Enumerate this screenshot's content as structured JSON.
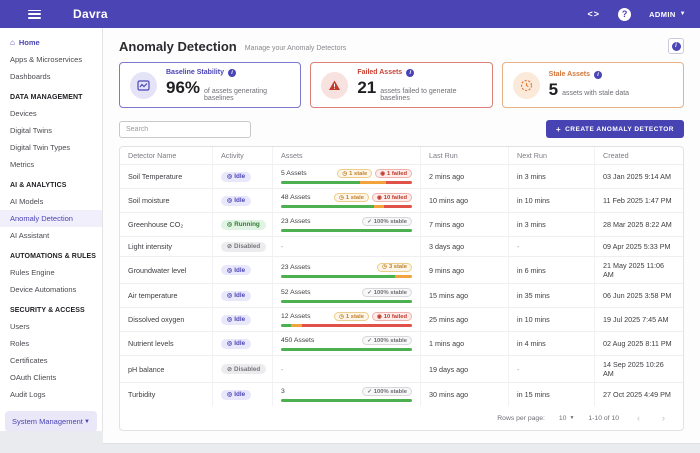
{
  "topbar": {
    "logo": "Davra",
    "code_icon": "<>",
    "help_icon": "?",
    "user_label": "ADMIN"
  },
  "sidebar": {
    "items": [
      {
        "type": "home",
        "label": "Home"
      },
      {
        "type": "link",
        "label": "Apps & Microservices"
      },
      {
        "type": "link",
        "label": "Dashboards"
      },
      {
        "type": "section",
        "label": "DATA MANAGEMENT"
      },
      {
        "type": "link",
        "label": "Devices"
      },
      {
        "type": "link",
        "label": "Digital Twins"
      },
      {
        "type": "link",
        "label": "Digital Twin Types"
      },
      {
        "type": "link",
        "label": "Metrics"
      },
      {
        "type": "section",
        "label": "AI & ANALYTICS"
      },
      {
        "type": "link",
        "label": "AI Models"
      },
      {
        "type": "link",
        "label": "Anomaly Detection",
        "selected": true
      },
      {
        "type": "link",
        "label": "AI Assistant"
      },
      {
        "type": "section",
        "label": "AUTOMATIONS & RULES"
      },
      {
        "type": "link",
        "label": "Rules Engine"
      },
      {
        "type": "link",
        "label": "Device Automations"
      },
      {
        "type": "section",
        "label": "SECURITY & ACCESS"
      },
      {
        "type": "link",
        "label": "Users"
      },
      {
        "type": "link",
        "label": "Roles"
      },
      {
        "type": "link",
        "label": "Certificates"
      },
      {
        "type": "link",
        "label": "OAuth Clients"
      },
      {
        "type": "link",
        "label": "Audit Logs"
      },
      {
        "type": "dropdown",
        "label": "System Management"
      }
    ]
  },
  "header": {
    "title": "Anomaly Detection",
    "subtitle": "Manage your Anomaly Detectors"
  },
  "cards": [
    {
      "title": "Baseline Stability",
      "value": "96%",
      "description": "of assets generating baselines",
      "color": "#4a44b6",
      "icon": "baseline-chart-icon"
    },
    {
      "title": "Failed Assets",
      "value": "21",
      "description": "assets failed to generate baselines",
      "color": "#cb4335",
      "icon": "warning-triangle-icon"
    },
    {
      "title": "Stale Assets",
      "value": "5",
      "description": "assets with stale data",
      "color": "#d2763a",
      "icon": "stale-clock-icon"
    }
  ],
  "toolbar": {
    "search_placeholder": "Search",
    "create_button": "CREATE ANOMALY DETECTOR"
  },
  "table": {
    "columns": [
      "Detector Name",
      "Activity",
      "Assets",
      "Last Run",
      "Next Run",
      "Created"
    ],
    "rows": [
      {
        "name": "Soil Temperature",
        "activity": "Idle",
        "assets_label": "5 Assets",
        "badges": [
          {
            "type": "stale",
            "label": "1 stale"
          },
          {
            "type": "failed",
            "label": "1 failed"
          }
        ],
        "bar": {
          "stable": 60,
          "stale": 20,
          "failed": 20
        },
        "last_run": "2 mins ago",
        "next_run": "in 3 mins",
        "created": "03 Jan 2025 9:14 AM"
      },
      {
        "name": "Soil moisture",
        "activity": "Idle",
        "assets_label": "48 Assets",
        "badges": [
          {
            "type": "stale",
            "label": "1 stale"
          },
          {
            "type": "failed",
            "label": "10 failed"
          }
        ],
        "bar": {
          "stable": 71,
          "stale": 8,
          "failed": 21
        },
        "last_run": "10 mins ago",
        "next_run": "in 10 mins",
        "created": "11 Feb 2025 1:47 PM"
      },
      {
        "name": "Greenhouse CO₂",
        "activity": "Running",
        "assets_label": "23 Assets",
        "badges": [
          {
            "type": "stable",
            "label": "100% stable"
          }
        ],
        "bar": {
          "stable": 100,
          "stale": 0,
          "failed": 0
        },
        "last_run": "7 mins ago",
        "next_run": "in 3 mins",
        "created": "28 Mar 2025 8:22 AM"
      },
      {
        "name": "Light intensity",
        "activity": "Disabled",
        "assets_label": "-",
        "badges": [],
        "bar": null,
        "last_run": "3 days ago",
        "next_run": "-",
        "created": "09 Apr 2025 5:33 PM"
      },
      {
        "name": "Groundwater level",
        "activity": "Idle",
        "assets_label": "23 Assets",
        "badges": [
          {
            "type": "stale",
            "label": "3 stale"
          }
        ],
        "bar": {
          "stable": 87,
          "stale": 13,
          "failed": 0
        },
        "last_run": "9 mins ago",
        "next_run": "in 6 mins",
        "created": "21 May 2025 11:06 AM"
      },
      {
        "name": "Air temperature",
        "activity": "Idle",
        "assets_label": "52 Assets",
        "badges": [
          {
            "type": "stable",
            "label": "100% stable"
          }
        ],
        "bar": {
          "stable": 100,
          "stale": 0,
          "failed": 0
        },
        "last_run": "15 mins ago",
        "next_run": "in 35 mins",
        "created": "06 Jun 2025 3:58 PM"
      },
      {
        "name": "Dissolved oxygen",
        "activity": "Idle",
        "assets_label": "12 Assets",
        "badges": [
          {
            "type": "stale",
            "label": "1 stale"
          },
          {
            "type": "failed",
            "label": "10 failed"
          }
        ],
        "bar": {
          "stable": 8,
          "stale": 8,
          "failed": 84
        },
        "last_run": "25 mins ago",
        "next_run": "in 10 mins",
        "created": "19 Jul 2025 7:45 AM"
      },
      {
        "name": "Nutrient levels",
        "activity": "Idle",
        "assets_label": "450 Assets",
        "badges": [
          {
            "type": "stable",
            "label": "100% stable"
          }
        ],
        "bar": {
          "stable": 100,
          "stale": 0,
          "failed": 0
        },
        "last_run": "1 mins ago",
        "next_run": "in 4 mins",
        "created": "02 Aug 2025 8:11 PM"
      },
      {
        "name": "pH balance",
        "activity": "Disabled",
        "assets_label": "-",
        "badges": [],
        "bar": null,
        "last_run": "19 days ago",
        "next_run": "-",
        "created": "14 Sep 2025 10:26 AM"
      },
      {
        "name": "Turbidity",
        "activity": "Idle",
        "assets_label": "3",
        "badges": [
          {
            "type": "stable",
            "label": "100% stable"
          }
        ],
        "bar": {
          "stable": 100,
          "stale": 0,
          "failed": 0
        },
        "last_run": "30 mins ago",
        "next_run": "in 15 mins",
        "created": "27 Oct 2025 4:49 PM"
      }
    ],
    "footer": {
      "rows_per_page_label": "Rows per page:",
      "rows_per_page": "10",
      "range": "1-10 of 10"
    }
  },
  "colors": {
    "primary": "#4b44b4",
    "stable_green": "#4caf50",
    "stale_orange": "#f2a33c",
    "failed_red": "#e05249"
  }
}
